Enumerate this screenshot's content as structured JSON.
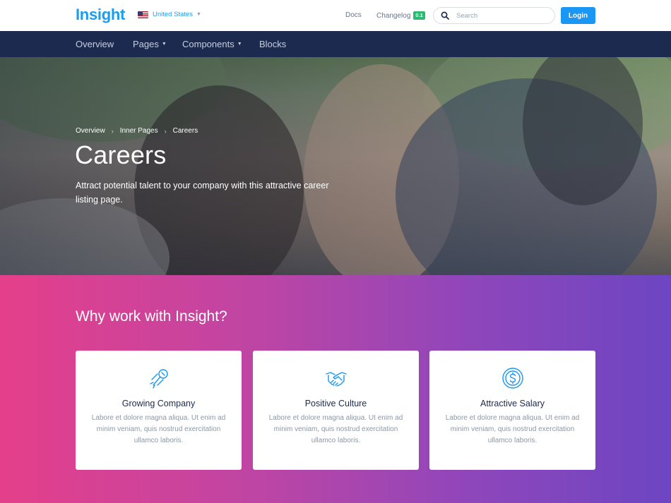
{
  "header": {
    "logo": "Insight",
    "country": "United States",
    "docs": "Docs",
    "changelog": "Changelog",
    "changelog_badge": "0.1",
    "search_placeholder": "Search",
    "login": "Login"
  },
  "nav": {
    "items": [
      {
        "label": "Overview",
        "dropdown": false
      },
      {
        "label": "Pages",
        "dropdown": true
      },
      {
        "label": "Components",
        "dropdown": true
      },
      {
        "label": "Blocks",
        "dropdown": false
      }
    ]
  },
  "hero": {
    "breadcrumb": [
      "Overview",
      "Inner Pages",
      "Careers"
    ],
    "title": "Careers",
    "description": "Attract potential talent to your company with this attractive career listing page."
  },
  "features": {
    "title": "Why work with Insight?",
    "cards": [
      {
        "icon": "rocket-icon",
        "title": "Growing Company",
        "text": "Labore et dolore magna aliqua. Ut enim ad minim veniam, quis nostrud exercitation ullamco laboris."
      },
      {
        "icon": "handshake-icon",
        "title": "Positive Culture",
        "text": "Labore et dolore magna aliqua. Ut enim ad minim veniam, quis nostrud exercitation ullamco laboris."
      },
      {
        "icon": "dollar-coin-icon",
        "title": "Attractive Salary",
        "text": "Labore et dolore magna aliqua. Ut enim ad minim veniam, quis nostrud exercitation ullamco laboris."
      }
    ]
  },
  "colors": {
    "brand": "#1a9cf0",
    "navbar": "#1b2a4e",
    "gradient_start": "#e53f8a",
    "gradient_end": "#6d45c2"
  }
}
